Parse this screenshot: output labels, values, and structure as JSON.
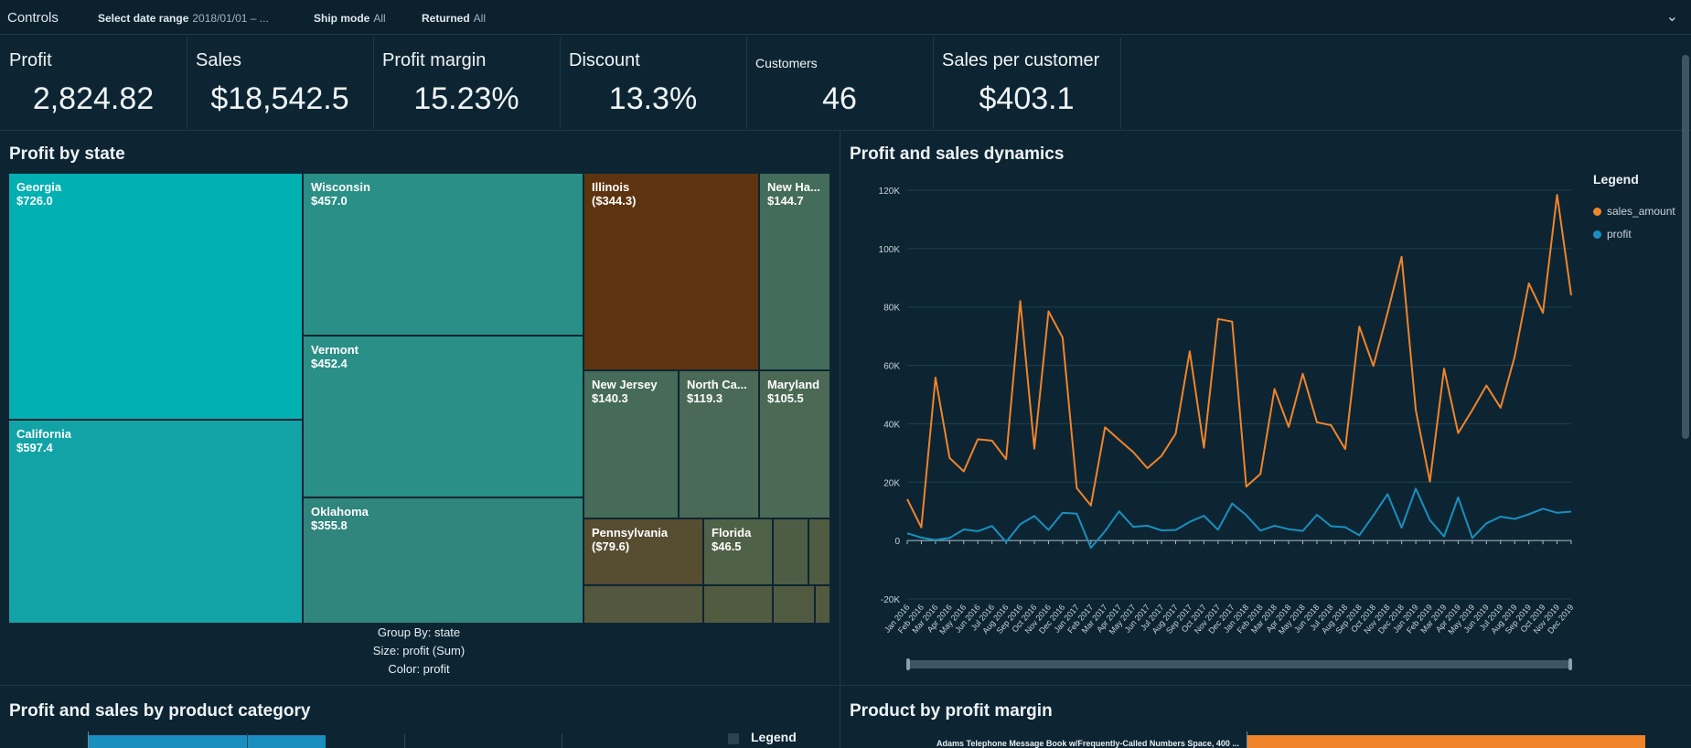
{
  "controls": {
    "title": "Controls",
    "filters": [
      {
        "label": "Select date range",
        "value": "2018/01/01 – ..."
      },
      {
        "label": "Ship mode",
        "value": "All"
      },
      {
        "label": "Returned",
        "value": "All"
      }
    ]
  },
  "kpis": [
    {
      "label": "Profit",
      "value": "2,824.82"
    },
    {
      "label": "Sales",
      "value": "$18,542.5"
    },
    {
      "label": "Profit margin",
      "value": "15.23%"
    },
    {
      "label": "Discount",
      "value": "13.3%"
    },
    {
      "label": "Customers",
      "value": "46"
    },
    {
      "label": "Sales per customer",
      "value": "$403.1"
    }
  ],
  "treemap": {
    "title": "Profit by state",
    "cells": [
      {
        "name": "Georgia",
        "value": "$726.0",
        "color": "#00b0b3"
      },
      {
        "name": "California",
        "value": "$597.4",
        "color": "#12a3a6"
      },
      {
        "name": "Wisconsin",
        "value": "$457.0",
        "color": "#2a8f86"
      },
      {
        "name": "Vermont",
        "value": "$452.4",
        "color": "#2a8f86"
      },
      {
        "name": "Oklahoma",
        "value": "$355.8",
        "color": "#30857c"
      },
      {
        "name": "Illinois",
        "value": "($344.3)",
        "color": "#5e330f"
      },
      {
        "name": "New Ha...",
        "value": "$144.7",
        "color": "#446c5a"
      },
      {
        "name": "New Jersey",
        "value": "$140.3",
        "color": "#466b58"
      },
      {
        "name": "North Ca...",
        "value": "$119.3",
        "color": "#4a6956"
      },
      {
        "name": "Maryland",
        "value": "$105.5",
        "color": "#4b6954"
      },
      {
        "name": "Pennsylvania",
        "value": "($79.6)",
        "color": "#574d30"
      },
      {
        "name": "Florida",
        "value": "$46.5",
        "color": "#4f6146"
      }
    ],
    "footer": [
      "Group By: state",
      "Size: profit (Sum)",
      "Color: profit"
    ]
  },
  "chart_data": {
    "type": "line",
    "title": "Profit and sales dynamics",
    "x": [
      "Jan 2016",
      "Feb 2016",
      "Mar 2016",
      "Apr 2016",
      "May 2016",
      "Jun 2016",
      "Jul 2016",
      "Aug 2016",
      "Sep 2016",
      "Oct 2016",
      "Nov 2016",
      "Dec 2016",
      "Jan 2017",
      "Feb 2017",
      "Mar 2017",
      "Apr 2017",
      "May 2017",
      "Jun 2017",
      "Jul 2017",
      "Aug 2017",
      "Sep 2017",
      "Oct 2017",
      "Nov 2017",
      "Dec 2017",
      "Jan 2018",
      "Feb 2018",
      "Mar 2018",
      "Apr 2018",
      "May 2018",
      "Jun 2018",
      "Jul 2018",
      "Aug 2018",
      "Sep 2018",
      "Oct 2018",
      "Nov 2018",
      "Dec 2018",
      "Jan 2019",
      "Feb 2019",
      "Mar 2019",
      "Apr 2019",
      "May 2019",
      "Jun 2019",
      "Jul 2019",
      "Aug 2019",
      "Sep 2019",
      "Oct 2019",
      "Nov 2019",
      "Dec 2019"
    ],
    "series": [
      {
        "name": "sales_amount",
        "color": "#f0842a",
        "values": [
          14200,
          4500,
          55800,
          28300,
          23700,
          34700,
          34200,
          27900,
          82000,
          31500,
          78500,
          69500,
          18000,
          12000,
          38800,
          34500,
          30300,
          24800,
          29000,
          36600,
          64800,
          31800,
          75900,
          75000,
          18500,
          22800,
          51900,
          38900,
          57100,
          40500,
          39500,
          31300,
          73300,
          59800,
          78000,
          97200,
          44600,
          20200,
          58900,
          36800,
          44700,
          53100,
          45500,
          63000,
          88100,
          78000,
          118400,
          84000
        ]
      },
      {
        "name": "profit",
        "color": "#1a8fbf",
        "values": [
          2500,
          1000,
          200,
          900,
          3800,
          3200,
          5000,
          -500,
          5600,
          8400,
          3600,
          9500,
          9200,
          -2500,
          3200,
          10000,
          4700,
          5100,
          3500,
          3600,
          6400,
          8500,
          3700,
          12700,
          8700,
          3400,
          5100,
          3900,
          3300,
          8800,
          4900,
          4600,
          1800,
          8600,
          15900,
          4400,
          17800,
          7000,
          1400,
          14800,
          900,
          5900,
          8200,
          7400,
          9000,
          10900,
          9500,
          9900
        ]
      }
    ],
    "ylim": [
      -20000,
      120000
    ],
    "yticks": [
      "-20K",
      "0",
      "20K",
      "40K",
      "60K",
      "80K",
      "100K",
      "120K"
    ],
    "legend": {
      "title": "Legend",
      "position": "right"
    }
  },
  "bottom": {
    "left_title": "Profit and sales by product category",
    "left_legend": "Legend",
    "right_title": "Product by profit margin",
    "right_first_label": "Adams Telephone Message Book w/Frequently-Called Numbers Space, 400 ..."
  }
}
